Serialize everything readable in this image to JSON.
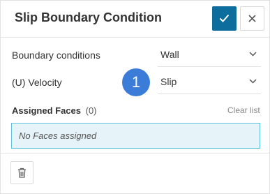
{
  "dialog": {
    "title": "Slip Boundary Condition",
    "confirm_icon": "check-icon",
    "close_icon": "close-icon",
    "accent_color": "#0d6e9e"
  },
  "fields": [
    {
      "label": "Boundary conditions",
      "value": "Wall"
    },
    {
      "label": "(U) Velocity",
      "value": "Slip"
    }
  ],
  "step_badge": "1",
  "assigned_faces": {
    "title": "Assigned Faces",
    "count": "(0)",
    "clear_label": "Clear list",
    "empty_text": "No Faces assigned"
  },
  "footer": {
    "delete_icon": "trash-icon"
  }
}
